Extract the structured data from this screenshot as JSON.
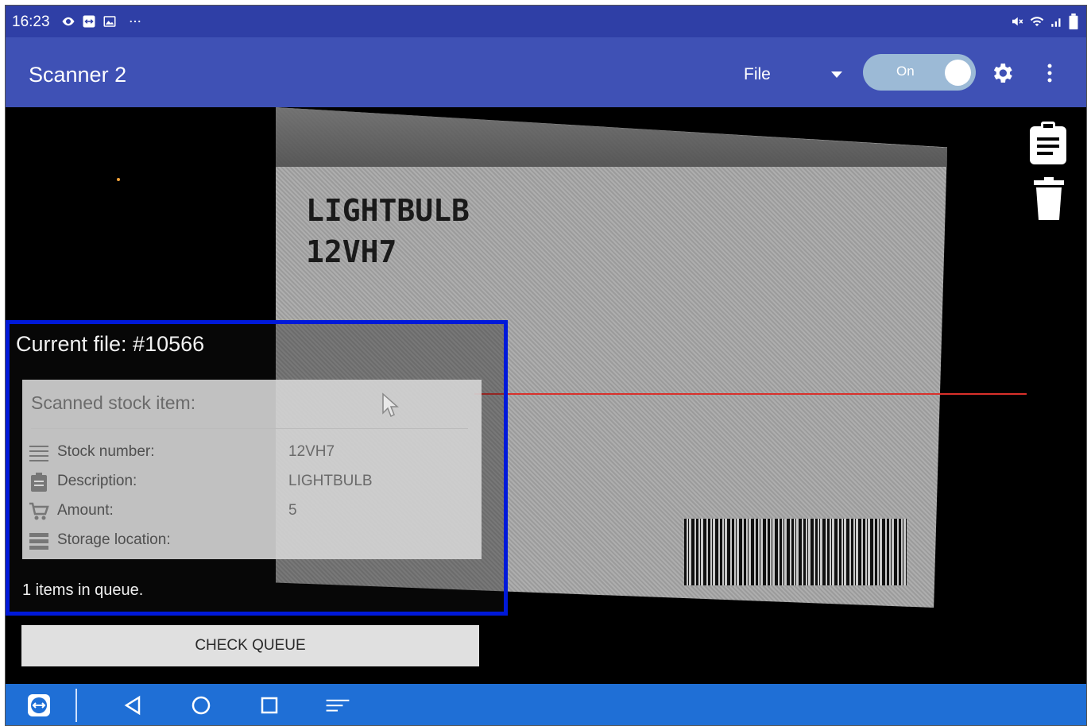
{
  "status_bar": {
    "time": "16:23",
    "icons_left": [
      "eye-icon",
      "teamviewer-icon",
      "image-icon",
      "more-dots-icon"
    ],
    "icons_right": [
      "mute-icon",
      "wifi-icon",
      "signal-icon",
      "battery-icon"
    ]
  },
  "app_bar": {
    "title": "Scanner 2",
    "file_label": "File",
    "toggle_label": "On",
    "toggle_state": true
  },
  "camera": {
    "card_line1": "LIGHTBULB",
    "card_line2": "12VH7"
  },
  "overlay": {
    "current_file": "Current file: #10566",
    "panel_title": "Scanned stock item:",
    "rows": [
      {
        "icon": "lines-icon",
        "label": "Stock number:",
        "value": "12VH7"
      },
      {
        "icon": "clipboard-icon",
        "label": "Description:",
        "value": "LIGHTBULB"
      },
      {
        "icon": "cart-icon",
        "label": "Amount:",
        "value": "5"
      },
      {
        "icon": "list-icon",
        "label": "Storage location:",
        "value": ""
      }
    ],
    "queue_text": "1 items in queue."
  },
  "check_queue_label": "CHECK QUEUE",
  "colors": {
    "status_bar": "#2f3fa6",
    "app_bar": "#3f51b5",
    "highlight_border": "#0019d9",
    "nav_bar": "#1f6fd6",
    "laser": "#d9302b"
  }
}
